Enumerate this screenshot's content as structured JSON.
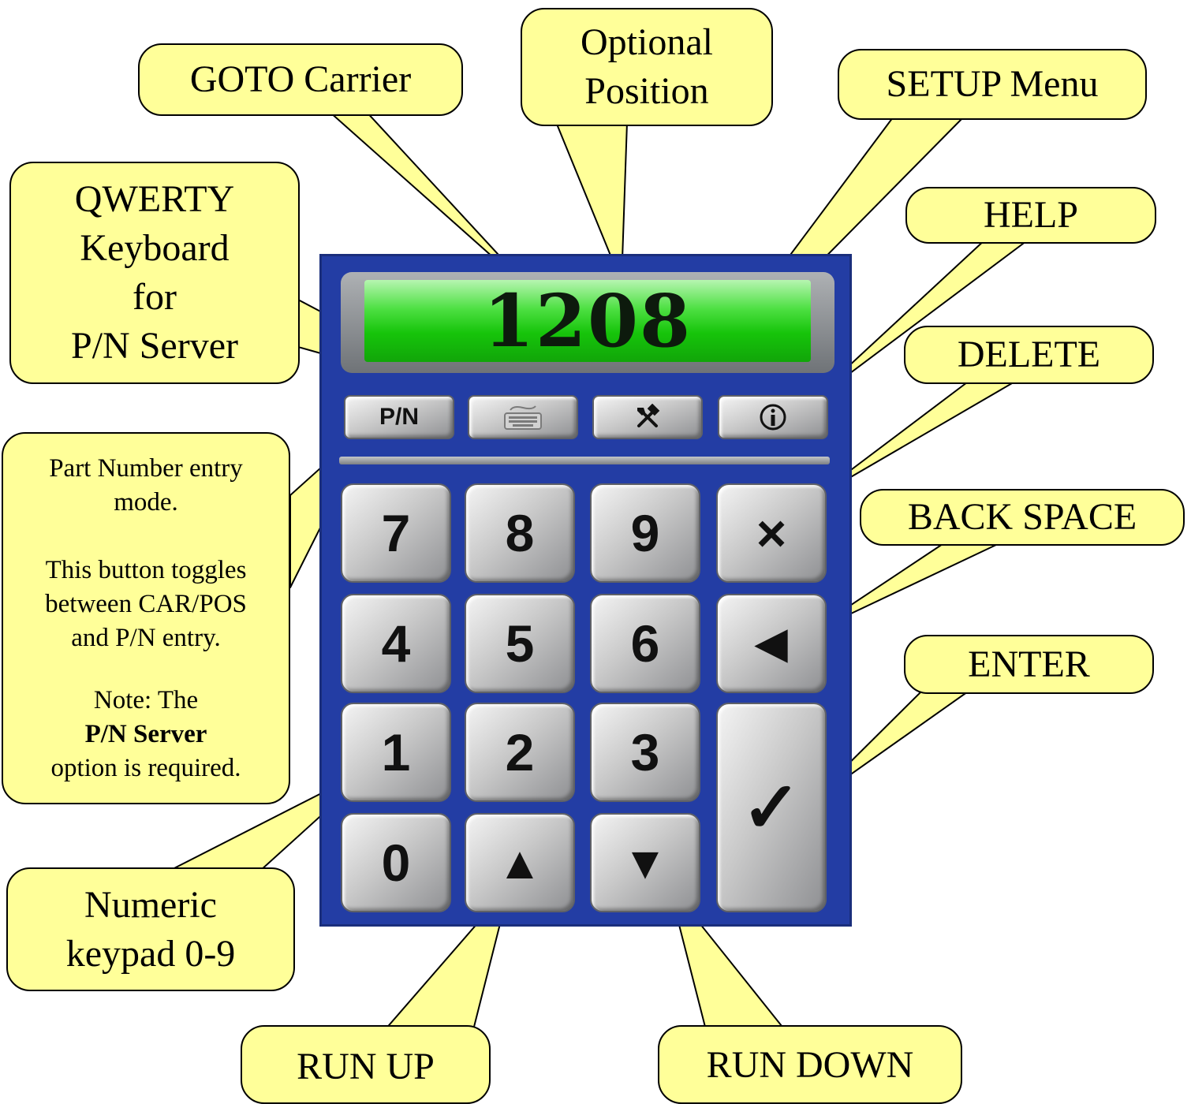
{
  "display": {
    "value": "1208"
  },
  "function_keys": {
    "pn": "P/N",
    "keyboard_icon": "keyboard-icon",
    "setup_icon": "tools-icon",
    "help_icon": "info-icon"
  },
  "keys": {
    "k7": "7",
    "k8": "8",
    "k9": "9",
    "k4": "4",
    "k5": "5",
    "k6": "6",
    "k1": "1",
    "k2": "2",
    "k3": "3",
    "k0": "0",
    "delete": "×",
    "backspace": "◀",
    "enter": "✓",
    "run_up": "▲",
    "run_down": "▼"
  },
  "callouts": {
    "goto_carrier": "GOTO Carrier",
    "optional_position": {
      "line1": "Optional",
      "line2": "Position"
    },
    "setup_menu": "SETUP Menu",
    "qwerty": {
      "line1": "QWERTY",
      "line2": "Keyboard",
      "line3": "for",
      "line4": "P/N Server"
    },
    "help": "HELP",
    "delete": "DELETE",
    "back_space": "BACK SPACE",
    "enter": "ENTER",
    "part_number": {
      "line1": "Part Number entry",
      "line2": "mode.",
      "line3": "This button toggles",
      "line4": "between CAR/POS",
      "line5": "and P/N entry.",
      "line6": "Note: The",
      "line7": "P/N Server",
      "line8": "option is required."
    },
    "numeric": {
      "line1": "Numeric",
      "line2": "keypad 0-9"
    },
    "run_up": "RUN UP",
    "run_down": "RUN DOWN"
  }
}
